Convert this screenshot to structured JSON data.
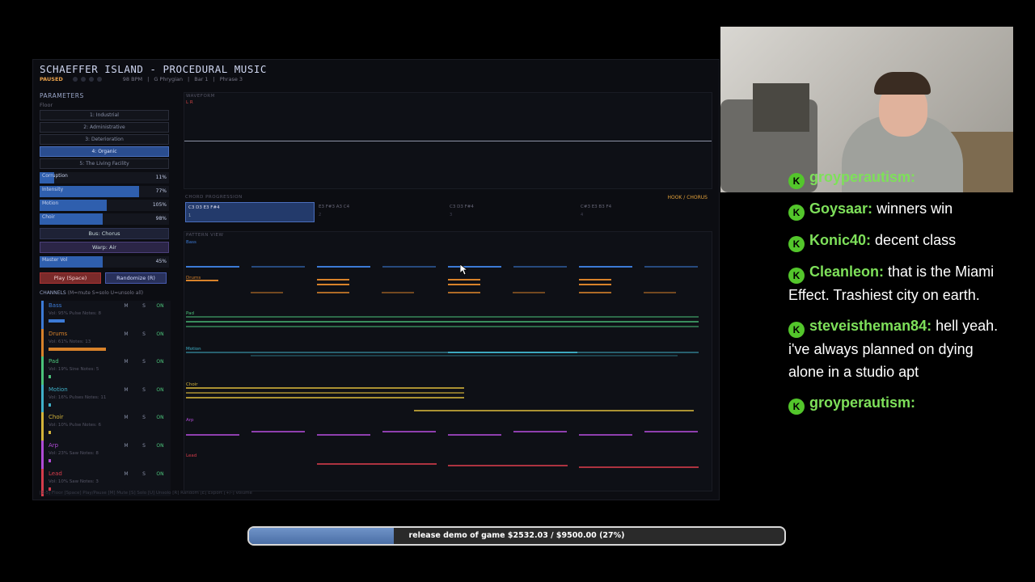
{
  "app": {
    "title": "SCHAEFFER ISLAND - PROCEDURAL MUSIC",
    "status": "PAUSED",
    "tempo": "98 BPM",
    "mode": "G Phrygian",
    "bar": "Bar 1",
    "phrase": "Phrase 3"
  },
  "params": {
    "title": "PARAMETERS",
    "floor_label": "Floor",
    "floors": [
      "1: Industrial",
      "2: Administrative",
      "3: Deterioration",
      "4: Organic",
      "5: The Living Facility"
    ],
    "active_floor": 3,
    "sliders": [
      {
        "label": "Corruption",
        "value": "11%",
        "level": 0.11
      },
      {
        "label": "Intensity",
        "value": "77%",
        "level": 0.77
      },
      {
        "label": "Motion",
        "value": "105%",
        "level": 0.52
      },
      {
        "label": "Choir",
        "value": "98%",
        "level": 0.49
      }
    ],
    "bus_chorus": "Bus: Chorus",
    "warp_air": "Warp: Air",
    "master_vol": {
      "label": "Master Vol",
      "value": "45%",
      "level": 0.49
    },
    "play_button": "Play (Space)",
    "randomize_button": "Randomize (R)"
  },
  "channels_header": {
    "title": "CHANNELS",
    "hint": "(M=mute S=solo U=unsolo all)"
  },
  "channels": [
    {
      "name": "Bass",
      "meta": "Vol: 95%  Pulse  Notes: 8",
      "color": "#3c7ad6",
      "bar": 0.13
    },
    {
      "name": "Drums",
      "meta": "Vol: 61%  Notes: 13",
      "color": "#d8822a",
      "bar": 0.47
    },
    {
      "name": "Pad",
      "meta": "Vol: 19%  Sine  Notes: 5",
      "color": "#4bc37a",
      "bar": 0.02
    },
    {
      "name": "Motion",
      "meta": "Vol: 16%  Pulses  Notes: 11",
      "color": "#3fb0c8",
      "bar": 0.02
    },
    {
      "name": "Choir",
      "meta": "Vol: 10%  Pulse  Notes: 6",
      "color": "#d3b33a",
      "bar": 0.02
    },
    {
      "name": "Arp",
      "meta": "Vol: 23%  Saw  Notes: 8",
      "color": "#b04bd6",
      "bar": 0.02
    },
    {
      "name": "Lead",
      "meta": "Vol: 10%  Saw  Notes: 3",
      "color": "#d63c4b",
      "bar": 0.02
    }
  ],
  "channel_controls": {
    "mute": "M",
    "solo": "S",
    "on": "ON"
  },
  "shortcuts": "[1-5] Floor  [Space] Play/Pause  [M] Mute  [S] Solo  [U] Unsolo  [R] Random  [E] Export  [+/-] Volume",
  "waveform": {
    "title": "WAVEFORM",
    "lr": "L R"
  },
  "chord_progression": {
    "title": "CHORD PROGRESSION",
    "section": "HOOK / CHORUS",
    "chords": [
      {
        "notes": "C3 D3 E3 F#4",
        "num": "1"
      },
      {
        "notes": "E3 F#3 A3 C4",
        "num": "2"
      },
      {
        "notes": "C3 D3 F#4",
        "num": "3"
      },
      {
        "notes": "C#3 E3 B3 F4",
        "num": "4"
      }
    ],
    "active": 0
  },
  "pattern": {
    "title": "PATTERN VIEW",
    "tracks": [
      "Bass",
      "Drums",
      "Pad",
      "Motion",
      "Choir",
      "Arp",
      "Lead"
    ]
  },
  "chat": [
    {
      "user": "groyperautism:",
      "msg": "",
      "color": "#7ee05a"
    },
    {
      "user": "Goysaar:",
      "msg": "winners win",
      "color": "#7ee05a"
    },
    {
      "user": "Konic40:",
      "msg": "decent class",
      "color": "#7ee05a"
    },
    {
      "user": "Cleanleon:",
      "msg": "that is the Miami Effect. Trashiest city on earth.",
      "color": "#7ee05a"
    },
    {
      "user": "steveistheman84:",
      "msg": "hell yeah. i've always planned on dying alone in a studio apt",
      "color": "#7ee05a"
    },
    {
      "user": "groyperautism:",
      "msg": "",
      "color": "#7ee05a"
    }
  ],
  "goal_bar": {
    "text": "release demo of game $2532.03 / $9500.00 (27%)",
    "progress": 0.27
  }
}
